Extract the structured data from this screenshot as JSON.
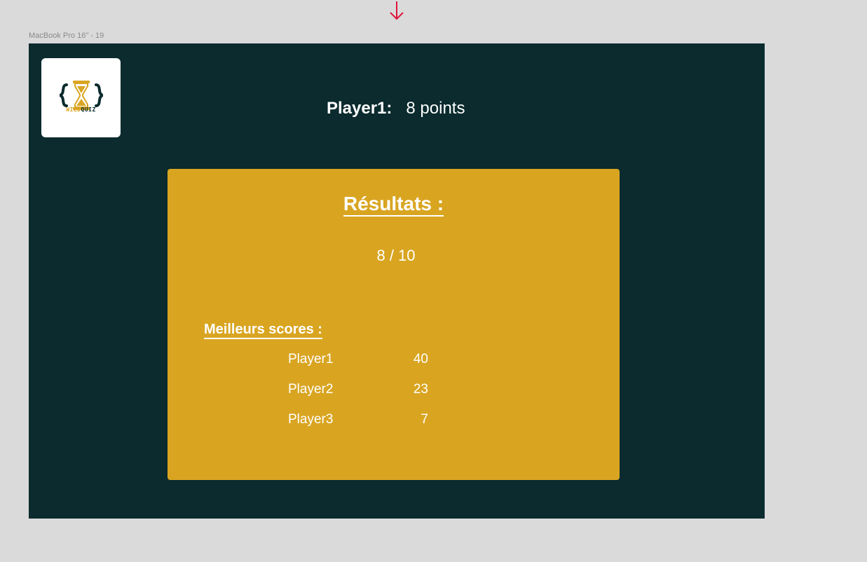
{
  "frame_label": "MacBook Pro 16\" - 19",
  "colors": {
    "canvas": "#dadada",
    "frame_bg": "#0b2b2e",
    "card_bg": "#d9a521",
    "text": "#ffffff",
    "arrow": "#e0143c"
  },
  "logo": {
    "icon": "hourglass-braces-logo",
    "text_wild": "WILD",
    "text_quiz": "QUIZ"
  },
  "header": {
    "player_name": "Player1:",
    "points": "8 points"
  },
  "results": {
    "title": "Résultats :",
    "score": "8 / 10",
    "best_scores_title": "Meilleurs scores :",
    "rows": [
      {
        "name": "Player1",
        "score": "40"
      },
      {
        "name": "Player2",
        "score": "23"
      },
      {
        "name": "Player3",
        "score": "7"
      }
    ]
  }
}
